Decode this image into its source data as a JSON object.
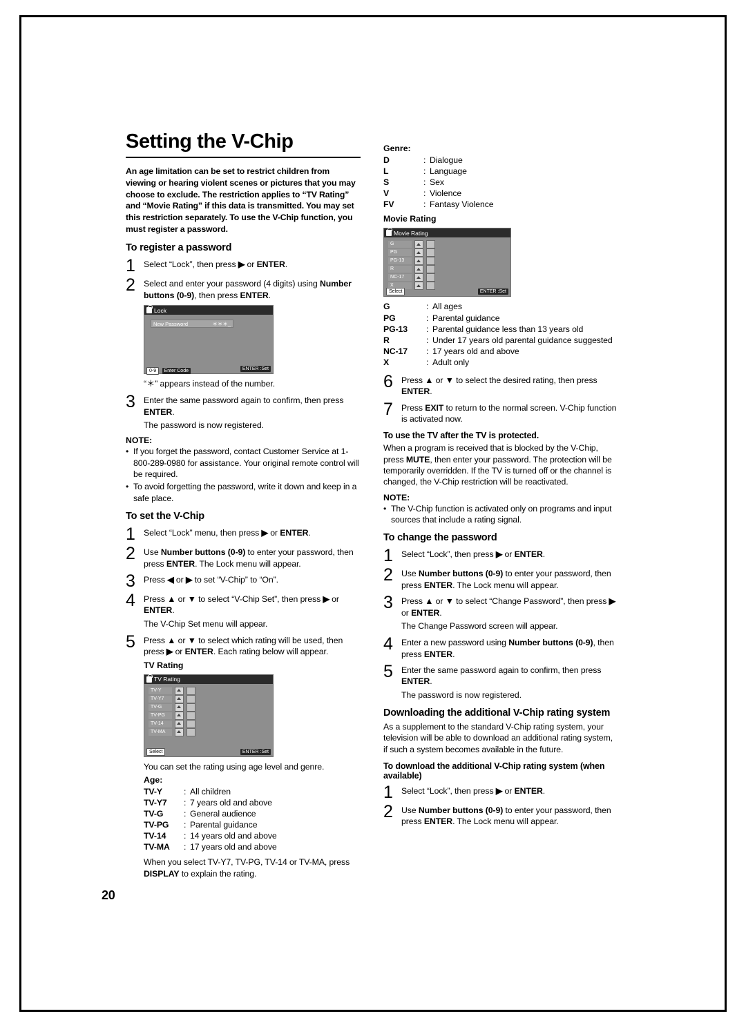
{
  "page": {
    "number": "20"
  },
  "title": "Setting the V-Chip",
  "intro": "An age limitation can be set to restrict children from viewing or hearing violent scenes or pictures that you may choose to exclude. The restriction applies to “TV Rating” and “Movie Rating” if this data is transmitted. You may set this restriction separately. To use the V-Chip function, you must register a password.",
  "left": {
    "register_heading": "To register a password",
    "register_steps": [
      {
        "num": "1",
        "html": "Select “Lock”, then press <b>&#9654;</b> or <b>ENTER</b>."
      },
      {
        "num": "2",
        "html": "Select and enter your password (4 digits) using <b>Number buttons (0-9)</b>, then press <b>ENTER</b>."
      }
    ],
    "lock_osd": {
      "title": "Lock",
      "field_label": "New Password",
      "field_value": "＊＊＊_",
      "foot_left": "0-9",
      "foot_left2": "Enter Code",
      "foot_right": "ENTER :Set"
    },
    "asterisk_note": "“＊” appears instead of the number.",
    "register_steps2": [
      {
        "num": "3",
        "html": "Enter the same password again to confirm, then press <b>ENTER</b>."
      }
    ],
    "registered_line": "The password is now registered.",
    "note_head": "NOTE:",
    "notes": [
      "If you forget the password, contact Customer Service at 1-800-289-0980 for assistance. Your original remote control will be required.",
      "To avoid forgetting the password, write it down and keep in a safe place."
    ],
    "set_heading": "To set the V-Chip",
    "set_steps": [
      {
        "num": "1",
        "html": "Select “Lock” menu, then press <b>&#9654;</b> or <b>ENTER</b>."
      },
      {
        "num": "2",
        "html": "Use <b>Number buttons (0-9)</b> to enter your password, then press <b>ENTER</b>. The Lock menu will appear."
      },
      {
        "num": "3",
        "html": "Press <b>&#9664;</b> or <b>&#9654;</b> to set “V-Chip” to “On”."
      },
      {
        "num": "4",
        "html": "Press <b>&#9650;</b> or <b>&#9660;</b> to select “V-Chip Set”, then press <b>&#9654;</b> or <b>ENTER</b>."
      },
      {
        "num": "5",
        "html": "Press <b>&#9650;</b> or <b>&#9660;</b> to select which rating will be used, then press <b>&#9654;</b> or <b>ENTER</b>. Each rating below will appear."
      }
    ],
    "step4_extra": "The V-Chip Set menu will appear.",
    "tv_rating_label": "TV Rating",
    "tv_rating_osd": {
      "title": "TV Rating",
      "rows": [
        "TV-Y",
        "TV-Y7",
        "TV-G",
        "TV-PG",
        "TV-14",
        "TV-MA"
      ],
      "foot_left": "Select",
      "foot_right": "ENTER :Set"
    },
    "rating_note": "You can set the rating using age level and genre.",
    "age_heading": "Age:",
    "age_items": [
      {
        "code": "TV-Y",
        "desc": "All children"
      },
      {
        "code": "TV-Y7",
        "desc": "7 years old and above"
      },
      {
        "code": "TV-G",
        "desc": "General audience"
      },
      {
        "code": "TV-PG",
        "desc": "Parental guidance"
      },
      {
        "code": "TV-14",
        "desc": "14 years old and above"
      },
      {
        "code": "TV-MA",
        "desc": "17 years old and above"
      }
    ],
    "display_note": "When you select TV-Y7, TV-PG, TV-14 or TV-MA, press <b>DISPLAY</b> to explain the rating."
  },
  "right": {
    "genre_heading": "Genre:",
    "genre_items": [
      {
        "code": "D",
        "desc": "Dialogue"
      },
      {
        "code": "L",
        "desc": "Language"
      },
      {
        "code": "S",
        "desc": "Sex"
      },
      {
        "code": "V",
        "desc": "Violence"
      },
      {
        "code": "FV",
        "desc": "Fantasy Violence"
      }
    ],
    "movie_rating_label": "Movie Rating",
    "movie_rating_osd": {
      "title": "Movie Rating",
      "rows": [
        "G",
        "PG",
        "PG-13",
        "R",
        "NC-17",
        "X"
      ],
      "foot_left": "Select",
      "foot_right": "ENTER :Set"
    },
    "movie_items": [
      {
        "code": "G",
        "desc": "All ages",
        "extra": ""
      },
      {
        "code": "PG",
        "desc": "Parental guidance",
        "extra": ""
      },
      {
        "code": "PG-13",
        "desc": "Parental guidance",
        "extra": " less than 13 years old"
      },
      {
        "code": "R",
        "desc": "Under 17 years old parental guidance suggested",
        "extra": ""
      },
      {
        "code": "NC-17",
        "desc": "17 years old and above",
        "extra": ""
      },
      {
        "code": "X",
        "desc": "Adult only",
        "extra": ""
      }
    ],
    "steps_67": [
      {
        "num": "6",
        "html": "Press <b>&#9650;</b> or <b>&#9660;</b> to select the desired rating, then press <b>ENTER</b>."
      },
      {
        "num": "7",
        "html": "Press <b>EXIT</b> to return to the normal screen. V-Chip function is activated now."
      }
    ],
    "protected_heading": "To use the TV after the TV is protected.",
    "protected_body": "When a program is received that is blocked by the V-Chip, press <b>MUTE</b>, then enter your password. The protection will be temporarily overridden. If the TV is turned off or the channel is changed, the V-Chip restriction will be reactivated.",
    "note_head": "NOTE:",
    "notes": [
      "The V-Chip function is activated only on programs and input sources that include a rating signal."
    ],
    "change_heading": "To change the password",
    "change_steps": [
      {
        "num": "1",
        "html": "Select “Lock”, then press <b>&#9654;</b> or <b>ENTER</b>."
      },
      {
        "num": "2",
        "html": "Use <b>Number buttons (0-9)</b> to enter your password, then press <b>ENTER</b>. The Lock menu will appear."
      },
      {
        "num": "3",
        "html": "Press <b>&#9650;</b> or <b>&#9660;</b> to select “Change Password”, then press <b>&#9654;</b> or <b>ENTER</b>."
      },
      {
        "num": "4",
        "html": "Enter a new password using <b>Number buttons (0-9)</b>, then press <b>ENTER</b>."
      },
      {
        "num": "5",
        "html": "Enter the same password again to confirm, then press <b>ENTER</b>."
      }
    ],
    "step3_extra": "The Change Password screen will appear.",
    "step5_extra": "The password is now registered.",
    "download_heading": "Downloading the additional V-Chip rating system",
    "download_body": "As a supplement to the standard V-Chip rating system, your television will be able to download an additional rating system, if such a system becomes available in the future.",
    "download_sub": "To download the additional V-Chip rating system (when available)",
    "download_steps": [
      {
        "num": "1",
        "html": "Select “Lock”, then press <b>&#9654;</b> or <b>ENTER</b>."
      },
      {
        "num": "2",
        "html": "Use <b>Number buttons (0-9)</b> to enter your password, then press <b>ENTER</b>. The Lock menu will appear."
      }
    ]
  }
}
